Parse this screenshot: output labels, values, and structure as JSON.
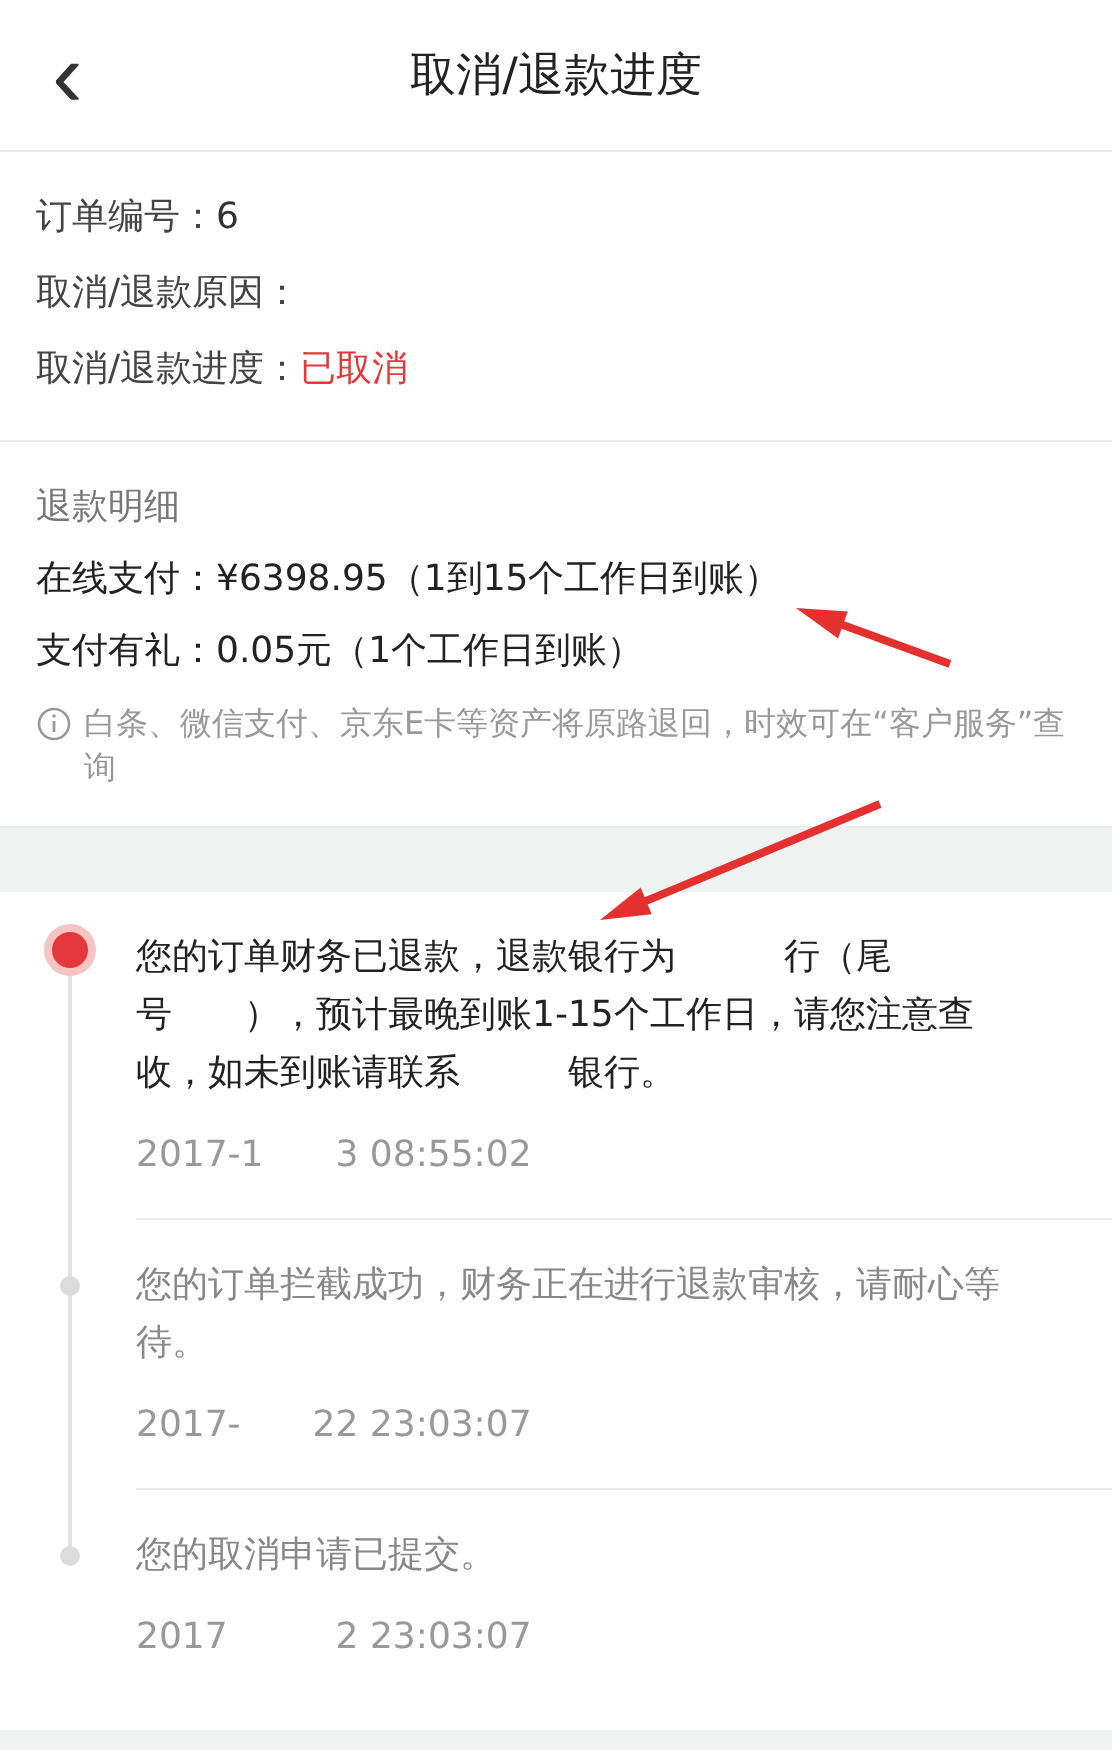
{
  "header": {
    "back": "‹",
    "title": "取消/退款进度"
  },
  "order": {
    "rows": [
      {
        "label": "订单编号：",
        "value": "6"
      },
      {
        "label": "取消/退款原因："
      },
      {
        "label": "取消/退款进度：",
        "value": "已取消",
        "kind": "status"
      }
    ]
  },
  "refund": {
    "title": "退款明细",
    "lines": [
      {
        "label": "在线支付：",
        "value": "¥6398.95（1到15个工作日到账）"
      },
      {
        "label": "支付有礼：",
        "value": "0.05元（1个工作日到账）"
      }
    ],
    "note": "白条、微信支付、京东E卡等资产将原路退回，时效可在“客户服务”查询"
  },
  "timeline": [
    {
      "active": true,
      "text": "您的订单财务已退款，退款银行为　　　行（尾号　　），预计最晚到账1-15个工作日，请您注意查收，如未到账请联系　　　银行。",
      "time": "2017-1　　3 08:55:02"
    },
    {
      "active": false,
      "text": "您的订单拦截成功，财务正在进行退款审核，请耐心等待。",
      "time": "2017-　　22 23:03:07"
    },
    {
      "active": false,
      "text": "您的取消申请已提交。",
      "time": "2017　　　2 23:03:07"
    }
  ]
}
